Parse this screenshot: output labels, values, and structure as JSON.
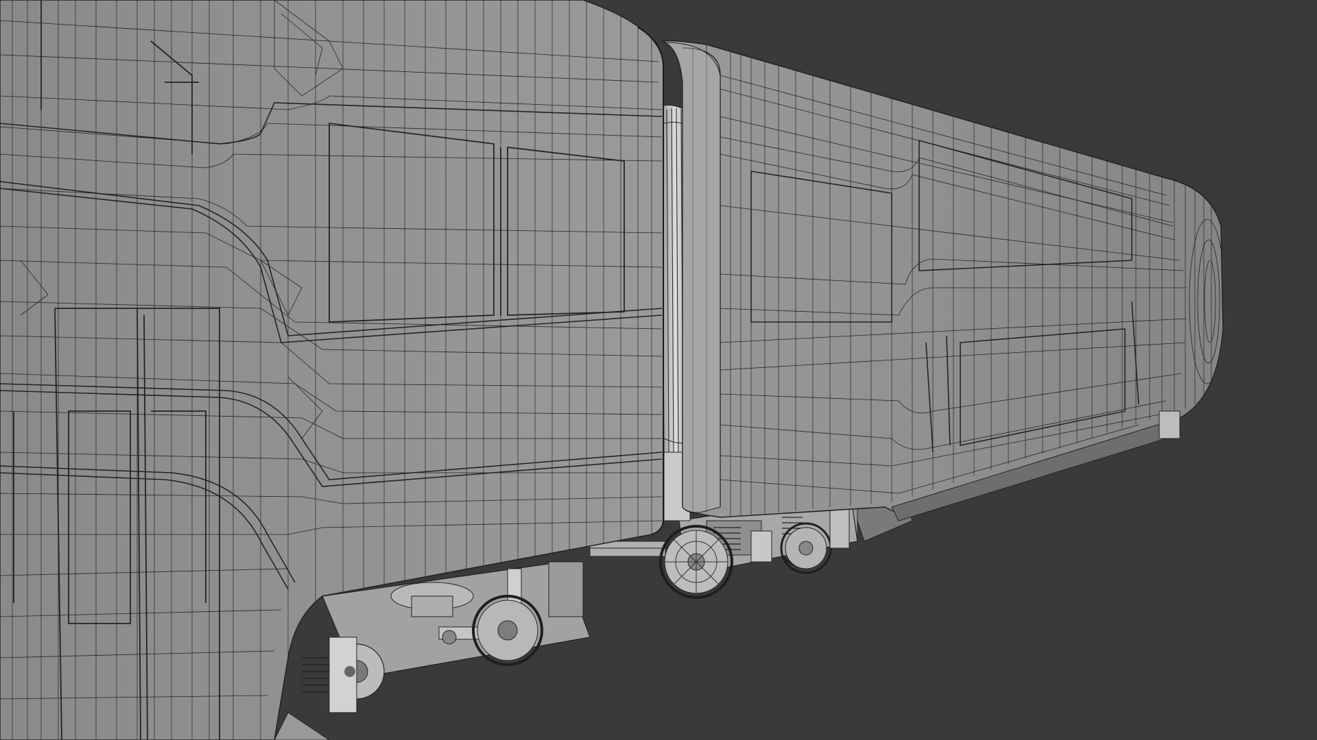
{
  "scene": {
    "subject": "train-wireframe-render",
    "colors": {
      "background": "#3a3a3a",
      "body_fill": "#8c8c8c",
      "body_light": "#a3a3a3",
      "wire": "#1e1e1e",
      "undercarriage": "#b4b4b4",
      "undercarriage_dark": "#5a5a5a"
    }
  }
}
